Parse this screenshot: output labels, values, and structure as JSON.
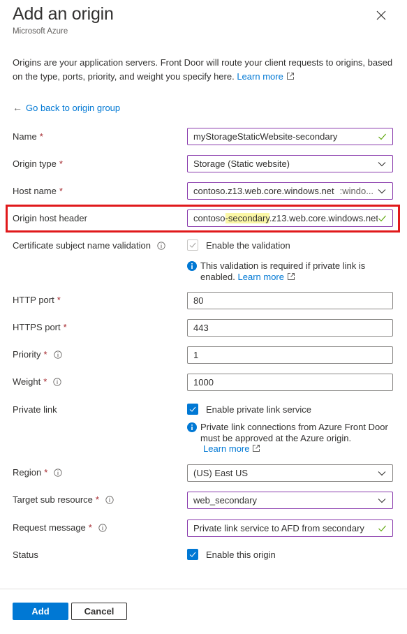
{
  "header": {
    "title": "Add an origin",
    "subtitle": "Microsoft Azure",
    "close_icon": "close-icon"
  },
  "intro": {
    "text": "Origins are your application servers. Front Door will route your client requests to origins, based on the type, ports, priority, and weight you specify here. ",
    "learn_more": "Learn more"
  },
  "back_link": {
    "arrow": "←",
    "label": "Go back to origin group"
  },
  "form": {
    "name": {
      "label": "Name",
      "required": "*",
      "value": "myStorageStaticWebsite-secondary"
    },
    "origin_type": {
      "label": "Origin type",
      "required": "*",
      "value": "Storage (Static website)"
    },
    "host_name": {
      "label": "Host name",
      "required": "*",
      "value": "contoso.z13.web.core.windows.net",
      "overflow_text": ":windo..."
    },
    "origin_host_header": {
      "label": "Origin host header",
      "value_prefix": "contoso",
      "value_highlight": "-secondary",
      "value_suffix": ".z13.web.core.windows.net"
    },
    "cert_validation": {
      "label": "Certificate subject name validation",
      "checkbox_label": "Enable the validation",
      "checked": true,
      "disabled": true,
      "note": "This validation is required if private link is enabled. ",
      "note_link": "Learn more"
    },
    "http_port": {
      "label": "HTTP port",
      "required": "*",
      "value": "80"
    },
    "https_port": {
      "label": "HTTPS port",
      "required": "*",
      "value": "443"
    },
    "priority": {
      "label": "Priority",
      "required": "*",
      "value": "1"
    },
    "weight": {
      "label": "Weight",
      "required": "*",
      "value": "1000"
    },
    "private_link": {
      "label": "Private link",
      "checkbox_label": "Enable private link service",
      "checked": true,
      "note": "Private link connections from Azure Front Door must be approved at the Azure origin.",
      "note_link": "Learn more"
    },
    "region": {
      "label": "Region",
      "required": "*",
      "value": "(US) East US"
    },
    "target_sub_resource": {
      "label": "Target sub resource",
      "required": "*",
      "value": "web_secondary"
    },
    "request_message": {
      "label": "Request message",
      "required": "*",
      "value": "Private link service to AFD from secondary"
    },
    "status": {
      "label": "Status",
      "checkbox_label": "Enable this origin",
      "checked": true
    }
  },
  "footer": {
    "add_label": "Add",
    "cancel_label": "Cancel"
  },
  "colors": {
    "accent": "#0078d4",
    "required": "#a4262c",
    "focus_border": "#8a3cad",
    "highlight_box": "#e0191b",
    "valid_check": "#57a300",
    "text_highlight": "#fbf7a6"
  }
}
